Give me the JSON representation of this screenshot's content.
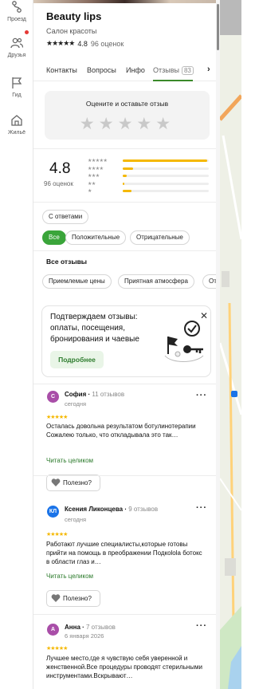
{
  "rail": {
    "items": [
      {
        "icon": "route-icon",
        "label": "Проезд"
      },
      {
        "icon": "friends-icon",
        "label": "Друзья"
      },
      {
        "icon": "guide-flag-icon",
        "label": "Гид"
      },
      {
        "icon": "housing-icon",
        "label": "Жильё"
      }
    ]
  },
  "place": {
    "title": "Beauty lips",
    "category": "Салон красоты",
    "rating": "4.8",
    "reviews_count": "96 оценок"
  },
  "tabs": {
    "items": [
      "Контакты",
      "Вопросы",
      "Инфо",
      "Отзывы"
    ],
    "badge": "83"
  },
  "rate_prompt": "Оцените и оставьте отзыв",
  "summary": {
    "rating": "4.8",
    "count": "96 оценок",
    "distribution": [
      0.98,
      0.12,
      0.05,
      0.02,
      0.1
    ]
  },
  "filters": {
    "with_photos": "С ответами",
    "all": "Все",
    "positive": "Положительные",
    "negative": "Отрицательные"
  },
  "all_reviews_title": "Все отзывы",
  "tags": [
    "Приемлемые цены",
    "Приятная атмосфера",
    "Отл"
  ],
  "promo": {
    "text": "Подтверждаем отзывы: оплаты, посещения, бронирования и чаевые",
    "button": "Подробнее"
  },
  "reviews": [
    {
      "initial": "С",
      "color": "#a94ea8",
      "name": "София",
      "meta": "11 отзывов",
      "date": "сегодня",
      "text": "Осталась довольна результатом ботулинотерапии Сожалею только, что откладывала это так…",
      "read_more": "Читать целиком",
      "useful": "Полезно?"
    },
    {
      "initial": "КЛ",
      "color": "#1a73e8",
      "name": "Ксения Ликонцева",
      "meta": "9 отзывов",
      "date": "сегодня",
      "text": "Работают лучшие специалисты,которые готовы прийти на помощь в преображении Подкolola ботокс в области глаз и…",
      "read_more": "Читать целиком",
      "useful": "Полезно?"
    },
    {
      "initial": "А",
      "color": "#a94ea8",
      "name": "Анна",
      "meta": "7 отзывов",
      "date": "6 января 2026",
      "text": "Лучшее место,где я чувствую себя уверенной и женственной.Все процедуры проводят стерильными инструментами.Вскрывают…",
      "read_more": "",
      "useful": ""
    }
  ],
  "colors": {
    "accent_green": "#3aa53a",
    "star_yellow": "#f5b800"
  }
}
